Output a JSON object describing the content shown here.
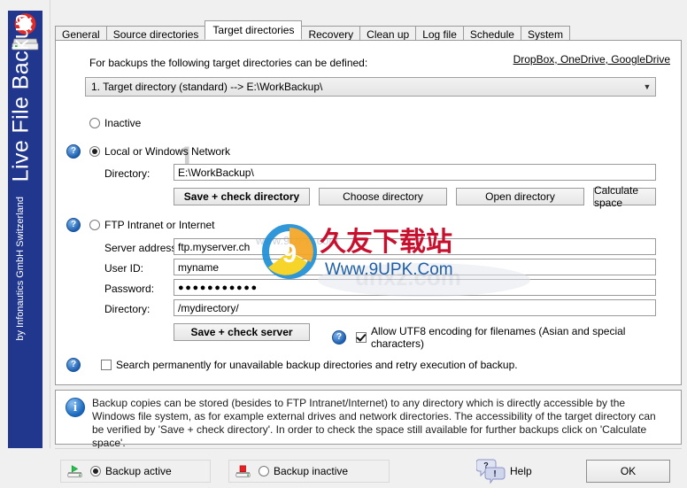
{
  "brand": {
    "title": "Live File Backup",
    "subtitle": "by Infonautics GmbH Switzerland",
    "rail_color": "#21378D",
    "logo_icon": "lifebuoy-harddrive-icon"
  },
  "tabs": [
    {
      "label": "General",
      "active": false
    },
    {
      "label": "Source directories",
      "active": false
    },
    {
      "label": "Target directories",
      "active": true
    },
    {
      "label": "Recovery",
      "active": false
    },
    {
      "label": "Clean up",
      "active": false
    },
    {
      "label": "Log file",
      "active": false
    },
    {
      "label": "Schedule",
      "active": false
    },
    {
      "label": "System",
      "active": false
    }
  ],
  "panel": {
    "lead_text": "For backups the following target directories can be defined:",
    "target_select": {
      "value": "1. Target directory (standard) --> E:\\WorkBackup\\",
      "arrow": "chevron-down-icon"
    },
    "slot_number": "1",
    "inactive": {
      "label": "Inactive",
      "checked": false
    },
    "local": {
      "label": "Local or Windows Network",
      "checked": true,
      "cloud_link": "DropBox, OneDrive, GoogleDrive",
      "directory_label": "Directory:",
      "directory_value": "E:\\WorkBackup\\",
      "buttons": [
        {
          "label": "Save + check directory",
          "bold": true
        },
        {
          "label": "Choose directory",
          "bold": false
        },
        {
          "label": "Open directory",
          "bold": false
        },
        {
          "label": "Calculate space",
          "bold": false
        }
      ]
    },
    "ftp": {
      "label": "FTP Intranet or Internet",
      "checked": false,
      "fields": [
        {
          "label": "Server address:",
          "value": "ftp.myserver.ch"
        },
        {
          "label": "User ID:",
          "value": "myname"
        },
        {
          "label": "Password:",
          "value": "●●●●●●●●●●●"
        },
        {
          "label": "Directory:",
          "value": "/mydirectory/"
        }
      ],
      "save_button": "Save + check server",
      "utf8": {
        "label": "Allow UTF8 encoding for filenames (Asian and special characters)",
        "checked": true
      }
    },
    "search_retry": {
      "label": "Search permanently for unavailable backup directories and retry execution of backup.",
      "checked": false
    }
  },
  "info": {
    "icon": "info-icon",
    "text": "Backup copies can be stored (besides to FTP Intranet/Internet) to any directory which is directly accessible by the Windows file system, as for example external drives and network directories. The accessibility of the target directory can be verified by 'Save + check directory'. In order to check the space still available for further backups click on 'Calculate space'."
  },
  "bottom": {
    "backup_active": {
      "label": "Backup active",
      "checked": true,
      "icon": "drive-play-icon"
    },
    "backup_inactive": {
      "label": "Backup inactive",
      "checked": false,
      "icon": "drive-stop-icon"
    },
    "help": {
      "label": "Help",
      "icon": "help-bubbles-icon"
    },
    "ok": {
      "label": "OK"
    }
  },
  "watermark": {
    "line1": "www.9UPK.com",
    "line2": "久友下载站",
    "line3": "Www.9UPK.Com",
    "line4": "unxz.com"
  }
}
